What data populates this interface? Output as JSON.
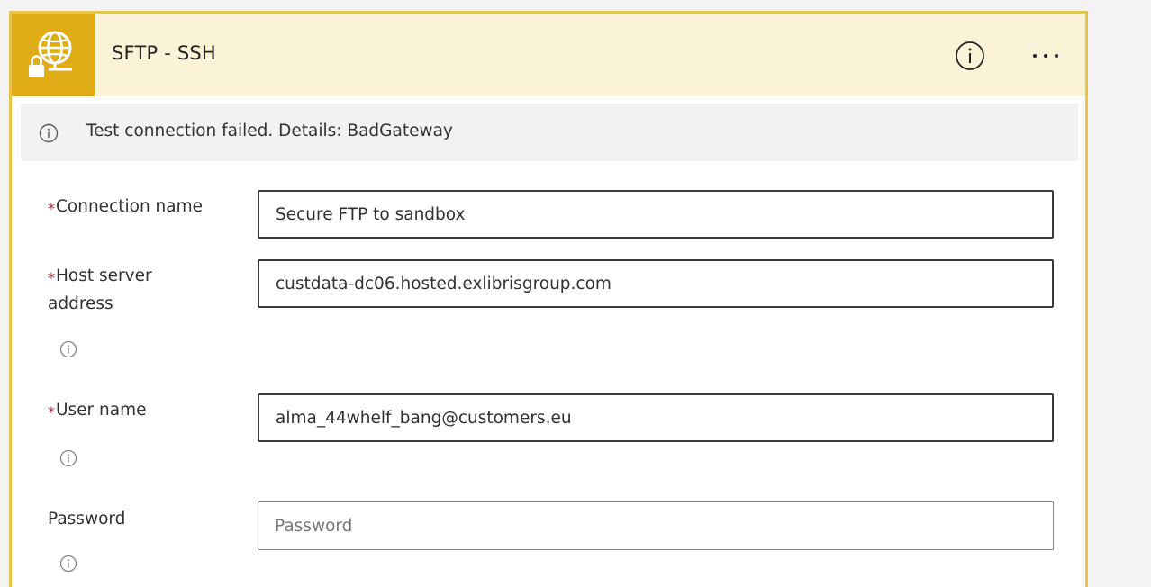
{
  "header": {
    "title": "SFTP - SSH"
  },
  "banner": {
    "message": "Test connection failed. Details: BadGateway"
  },
  "form": {
    "connection_name": {
      "required_mark": "*",
      "label": "Connection name",
      "value": "Secure FTP to sandbox"
    },
    "host_server_address": {
      "required_mark": "*",
      "label_line1": "Host server",
      "label_line2": "address",
      "value": "custdata-dc06.hosted.exlibrisgroup.com"
    },
    "user_name": {
      "required_mark": "*",
      "label": "User name",
      "value": "alma_44whelf_bang@customers.eu"
    },
    "password": {
      "label": "Password",
      "value": "",
      "placeholder": "Password"
    }
  },
  "icons": {
    "app": "globe-lock-icon",
    "header_info": "info-circle-icon",
    "more": "more-horizontal-icon",
    "banner": "info-circle-icon",
    "field_info": "info-circle-icon"
  },
  "colors": {
    "app_icon_bg": "#e0ad16",
    "header_bg": "#fbf3d8",
    "card_border": "#e8c54a",
    "banner_bg": "#f3f2f1",
    "required_star": "#a4262c"
  }
}
